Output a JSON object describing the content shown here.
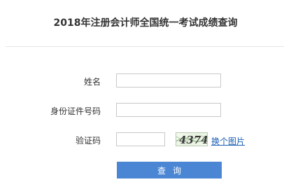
{
  "page": {
    "title": "2018年注册会计师全国统一考试成绩查询"
  },
  "form": {
    "name_label": "姓名",
    "name_value": "",
    "id_label": "身份证件号码",
    "id_value": "",
    "captcha_label": "验证码",
    "captcha_value": "",
    "captcha_image_text": "4374",
    "swap_link": "换个图片",
    "submit_label": "查询"
  },
  "colors": {
    "button": "#4a86d3",
    "link": "#1a5fb4"
  }
}
